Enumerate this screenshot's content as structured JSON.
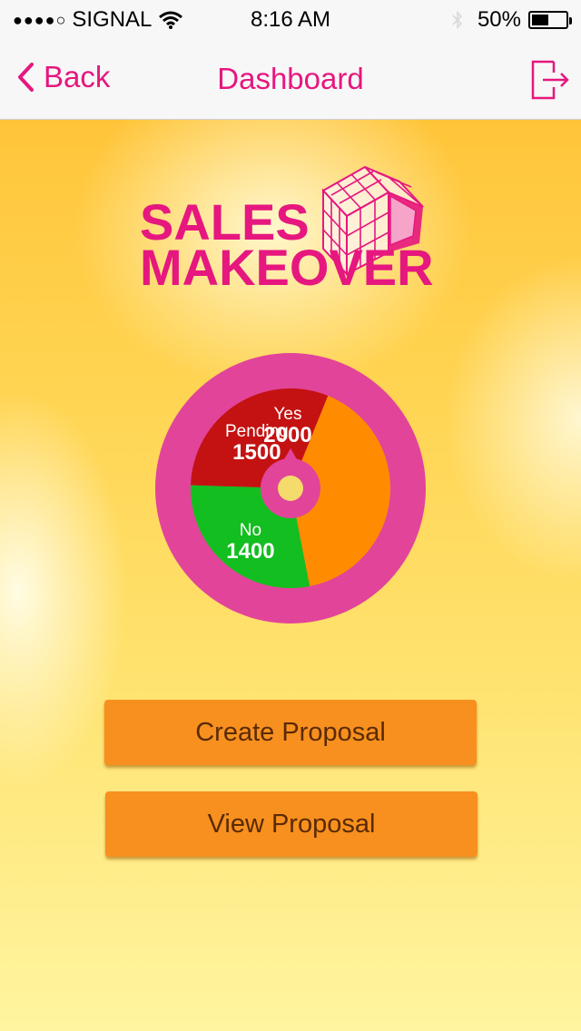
{
  "status_bar": {
    "signal_dots": "●●●●○",
    "carrier": "SIGNAL",
    "time": "8:16 AM",
    "battery_percent": "50%",
    "battery_level": 0.5
  },
  "nav": {
    "back_label": "Back",
    "title": "Dashboard"
  },
  "logo": {
    "line1": "SALES",
    "line2": "MAKEOVER"
  },
  "chart_data": {
    "type": "pie",
    "slices": [
      {
        "label": "Yes",
        "value": 2000,
        "color": "#ff8c00"
      },
      {
        "label": "No",
        "value": 1400,
        "color": "#13be20"
      },
      {
        "label": "Pending",
        "value": 1500,
        "color": "#c41212"
      }
    ],
    "ring_color": "#e2449a",
    "center_color": "#f5db6b"
  },
  "buttons": {
    "create_label": "Create Proposal",
    "view_label": "View Proposal"
  },
  "colors": {
    "accent": "#e6177f",
    "button": "#f7901e",
    "button_text": "#5a2a06"
  }
}
